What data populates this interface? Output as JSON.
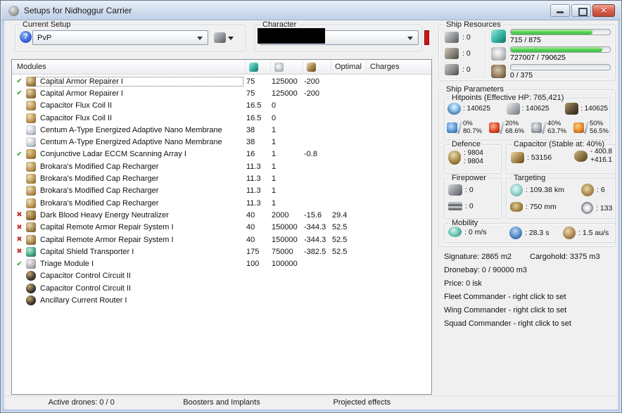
{
  "window": {
    "title": "Setups for Nidhoggur Carrier"
  },
  "toolbar": {
    "setup_group_label": "Current Setup",
    "setup_value": "PvP",
    "character_group_label": "Character"
  },
  "modules_table": {
    "header": {
      "name_label": "Modules",
      "optimal_label": "Optimal",
      "charges_label": "Charges"
    },
    "rows": [
      {
        "status": "ok",
        "icon": "armor-repairer",
        "sel": "selected",
        "name": "Capital Armor Repairer I",
        "cpu": "75",
        "pg": "125000",
        "cap": "-200",
        "optimal": "",
        "charges": ""
      },
      {
        "status": "ok",
        "icon": "armor-repairer",
        "sel": "",
        "name": "Capital Armor Repairer I",
        "cpu": "75",
        "pg": "125000",
        "cap": "-200",
        "optimal": "",
        "charges": ""
      },
      {
        "status": "",
        "icon": "cap-coil",
        "sel": "",
        "name": "Capacitor Flux Coil II",
        "cpu": "16.5",
        "pg": "0",
        "cap": "",
        "optimal": "",
        "charges": ""
      },
      {
        "status": "",
        "icon": "cap-coil",
        "sel": "",
        "name": "Capacitor Flux Coil II",
        "cpu": "16.5",
        "pg": "0",
        "cap": "",
        "optimal": "",
        "charges": ""
      },
      {
        "status": "",
        "icon": "membrane",
        "sel": "",
        "name": "Centum A-Type Energized Adaptive Nano Membrane",
        "cpu": "38",
        "pg": "1",
        "cap": "",
        "optimal": "",
        "charges": ""
      },
      {
        "status": "",
        "icon": "membrane",
        "sel": "",
        "name": "Centum A-Type Energized Adaptive Nano Membrane",
        "cpu": "38",
        "pg": "1",
        "cap": "",
        "optimal": "",
        "charges": ""
      },
      {
        "status": "ok",
        "icon": "scan-array",
        "sel": "",
        "name": "Conjunctive Ladar ECCM Scanning Array I",
        "cpu": "16",
        "pg": "1",
        "cap": "-0.8",
        "optimal": "",
        "charges": ""
      },
      {
        "status": "",
        "icon": "cap-recharger",
        "sel": "",
        "name": "Brokara's Modified Cap Recharger",
        "cpu": "11.3",
        "pg": "1",
        "cap": "",
        "optimal": "",
        "charges": ""
      },
      {
        "status": "",
        "icon": "cap-recharger",
        "sel": "",
        "name": "Brokara's Modified Cap Recharger",
        "cpu": "11.3",
        "pg": "1",
        "cap": "",
        "optimal": "",
        "charges": ""
      },
      {
        "status": "",
        "icon": "cap-recharger",
        "sel": "",
        "name": "Brokara's Modified Cap Recharger",
        "cpu": "11.3",
        "pg": "1",
        "cap": "",
        "optimal": "",
        "charges": ""
      },
      {
        "status": "",
        "icon": "cap-recharger",
        "sel": "",
        "name": "Brokara's Modified Cap Recharger",
        "cpu": "11.3",
        "pg": "1",
        "cap": "",
        "optimal": "",
        "charges": ""
      },
      {
        "status": "error",
        "icon": "neutralizer",
        "sel": "",
        "name": "Dark Blood Heavy Energy Neutralizer",
        "cpu": "40",
        "pg": "2000",
        "cap": "-15.6",
        "optimal": "29.4",
        "charges": ""
      },
      {
        "status": "error",
        "icon": "remote-armor",
        "sel": "",
        "name": "Capital Remote Armor Repair System I",
        "cpu": "40",
        "pg": "150000",
        "cap": "-344.3",
        "optimal": "52.5",
        "charges": ""
      },
      {
        "status": "error",
        "icon": "remote-armor",
        "sel": "",
        "name": "Capital Remote Armor Repair System I",
        "cpu": "40",
        "pg": "150000",
        "cap": "-344.3",
        "optimal": "52.5",
        "charges": ""
      },
      {
        "status": "error",
        "icon": "shield-transporter",
        "sel": "",
        "name": "Capital Shield Transporter I",
        "cpu": "175",
        "pg": "75000",
        "cap": "-382.5",
        "optimal": "52.5",
        "charges": ""
      },
      {
        "status": "ok",
        "icon": "triage",
        "sel": "",
        "name": "Triage Module I",
        "cpu": "100",
        "pg": "100000",
        "cap": "",
        "optimal": "",
        "charges": ""
      },
      {
        "status": "",
        "icon": "rig",
        "sel": "",
        "name": "Capacitor Control Circuit II",
        "cpu": "",
        "pg": "",
        "cap": "",
        "optimal": "",
        "charges": ""
      },
      {
        "status": "",
        "icon": "rig",
        "sel": "",
        "name": "Capacitor Control Circuit II",
        "cpu": "",
        "pg": "",
        "cap": "",
        "optimal": "",
        "charges": ""
      },
      {
        "status": "",
        "icon": "rig",
        "sel": "",
        "name": "Ancillary Current Router I",
        "cpu": "",
        "pg": "",
        "cap": "",
        "optimal": "",
        "charges": ""
      }
    ]
  },
  "bottom_bar": {
    "tabs": [
      "Active drones: 0 / 0",
      "Boosters and Implants",
      "Projected effects"
    ]
  },
  "ship_resources": {
    "title": "Ship Resources",
    "hardpoints": [
      {
        "icon": "turret-hardpoint",
        "value": ": 0"
      },
      {
        "icon": "launcher-hardpoint",
        "value": ": 0"
      },
      {
        "icon": "rig-hardpoint",
        "value": ": 0"
      }
    ],
    "bars": [
      {
        "icon": "cpu",
        "text": "715 / 875",
        "pct": 82
      },
      {
        "icon": "powergrid",
        "text": "727007 / 790625",
        "pct": 92
      },
      {
        "icon": "calibration",
        "text": "0 / 375",
        "pct": 0
      }
    ]
  },
  "ship_parameters": {
    "title": "Ship Parameters",
    "hitpoints": {
      "title": "Hitpoints (Effective HP: 765,421)",
      "items": [
        {
          "icon": "shield-hp",
          "value": ": 140625"
        },
        {
          "icon": "armor-hp",
          "value": ": 140625"
        },
        {
          "icon": "hull-hp",
          "value": ": 140625"
        }
      ],
      "resists": [
        {
          "icon": "em-resist",
          "top": "0%",
          "bottom": "80.7%"
        },
        {
          "icon": "thermal-resist",
          "top": "20%",
          "bottom": "68.6%"
        },
        {
          "icon": "kinetic-resist",
          "top": "40%",
          "bottom": "63.7%"
        },
        {
          "icon": "explosive-resist",
          "top": "50%",
          "bottom": "56.5%"
        }
      ]
    },
    "defence": {
      "title": "Defence",
      "line1": ": 9804",
      "line2": ": 9804"
    },
    "capacitor": {
      "title": "Capacitor (Stable at: 40%)",
      "amount": ": 53156",
      "drain": "- 400.8",
      "recharge": "+416.1"
    },
    "firepower": {
      "title": "Firepower",
      "turret": ": 0",
      "missile": ": 0"
    },
    "targeting": {
      "title": "Targeting",
      "range": ": 109.38 km",
      "max_targets": ": 6",
      "sig_radius": ": 750 mm",
      "scan_res": ": 133"
    },
    "mobility": {
      "title": "Mobility",
      "speed": ": 0 m/s",
      "align_time": ": 28.3 s",
      "warp_speed": ": 1.5 au/s"
    }
  },
  "ship_info": {
    "signature": "Signature: 2865 m2",
    "cargohold": "Cargohold: 3375 m3",
    "dronebay": "Dronebay: 0 / 90000 m3",
    "price": "Price: 0 isk",
    "commanders": [
      "Fleet Commander - right click to set",
      "Wing Commander - right click to set",
      "Squad Commander - right click to set"
    ]
  },
  "colors": {
    "bar_green": "#3cbf3c",
    "error_red": "#c43232",
    "ok_green": "#2f9e2f",
    "warning_red": "#d01414"
  }
}
